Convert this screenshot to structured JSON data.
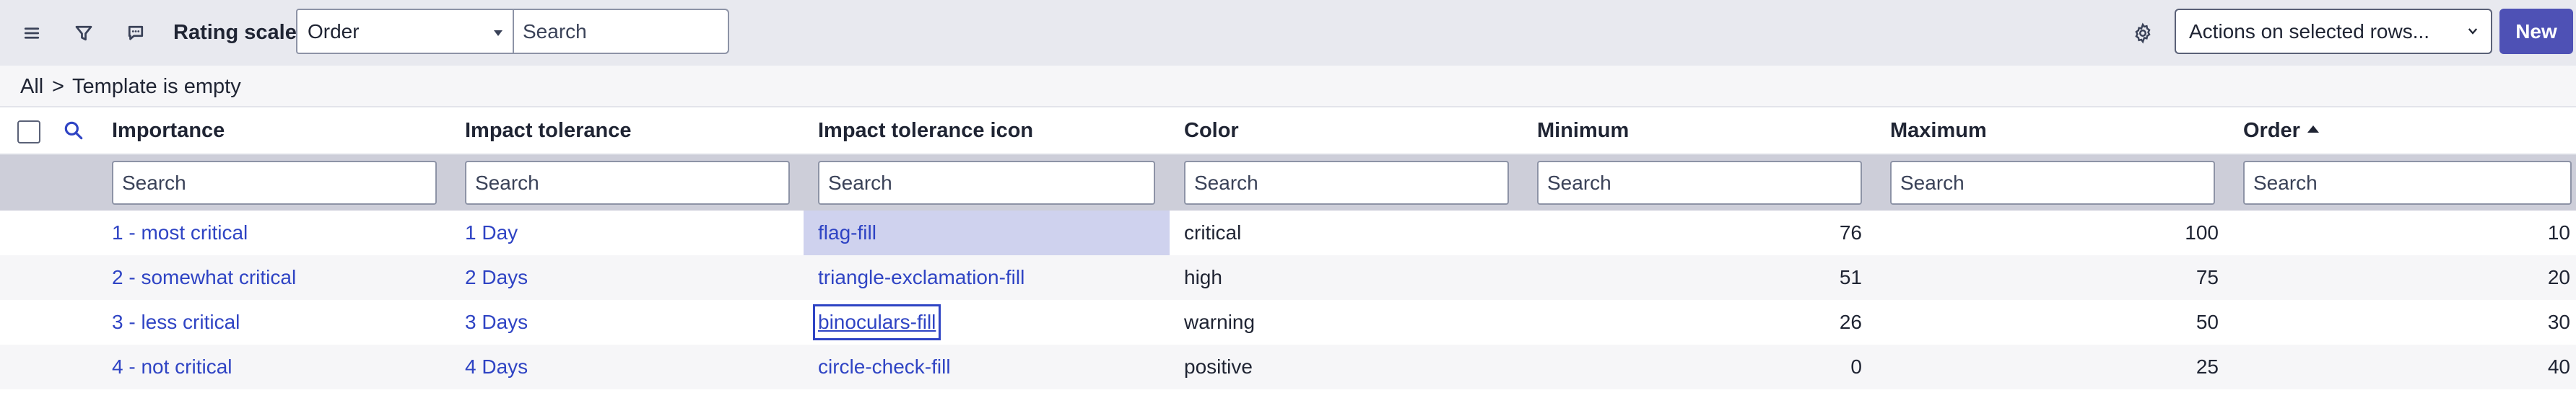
{
  "toolbar": {
    "list_title": "Rating scales",
    "field_select": "Order",
    "search_placeholder": "Search",
    "actions_label": "Actions on selected rows...",
    "new_label": "New"
  },
  "breadcrumb": {
    "all": "All",
    "separator": ">",
    "condition": "Template is empty"
  },
  "columns": [
    "Importance",
    "Impact tolerance",
    "Impact tolerance icon",
    "Color",
    "Minimum",
    "Maximum",
    "Order"
  ],
  "filter_placeholder": "Search",
  "rows": [
    {
      "importance": "1 - most critical",
      "impact_tolerance": "1 Day",
      "icon": "flag-fill",
      "color": "critical",
      "minimum": "76",
      "maximum": "100",
      "order": "10"
    },
    {
      "importance": "2 - somewhat critical",
      "impact_tolerance": "2 Days",
      "icon": "triangle-exclamation-fill",
      "color": "high",
      "minimum": "51",
      "maximum": "75",
      "order": "20"
    },
    {
      "importance": "3 - less critical",
      "impact_tolerance": "3 Days",
      "icon": "binoculars-fill",
      "color": "warning",
      "minimum": "26",
      "maximum": "50",
      "order": "30"
    },
    {
      "importance": "4 - not critical",
      "impact_tolerance": "4 Days",
      "icon": "circle-check-fill",
      "color": "positive",
      "minimum": "0",
      "maximum": "25",
      "order": "40"
    }
  ],
  "icons": {
    "menu": "hamburger-icon",
    "filter": "funnel-icon",
    "comment": "chat-bubble-icon",
    "settings": "gear-icon",
    "search": "magnifier-icon"
  },
  "colors": {
    "accent": "#4e51b5",
    "link": "#2f44c4",
    "toolbar_bg": "#e8e9ef",
    "filter_row_bg": "#cdced9",
    "selected_cell_bg": "#cfd2ee"
  }
}
